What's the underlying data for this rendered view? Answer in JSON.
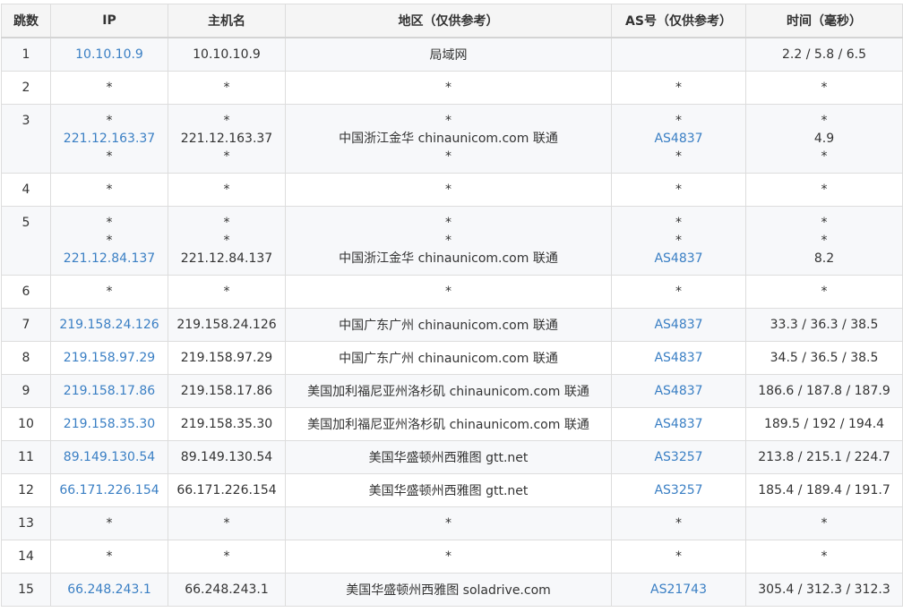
{
  "headers": [
    "跳数",
    "IP",
    "主机名",
    "地区（仅供参考）",
    "AS号（仅供参考）",
    "时间（毫秒）"
  ],
  "rows": [
    {
      "hop": "1",
      "ip": [
        "10.10.10.9"
      ],
      "host": [
        "10.10.10.9"
      ],
      "region": [
        "局域网"
      ],
      "as": [
        ""
      ],
      "time": [
        "2.2 / 5.8 / 6.5"
      ]
    },
    {
      "hop": "2",
      "ip": [
        "*"
      ],
      "host": [
        "*"
      ],
      "region": [
        "*"
      ],
      "as": [
        "*"
      ],
      "time": [
        "*"
      ]
    },
    {
      "hop": "3",
      "ip": [
        "*",
        "221.12.163.37",
        "*"
      ],
      "host": [
        "*",
        "221.12.163.37",
        "*"
      ],
      "region": [
        "*",
        "中国浙江金华 chinaunicom.com 联通",
        "*"
      ],
      "as": [
        "*",
        "AS4837",
        "*"
      ],
      "time": [
        "*",
        "4.9",
        "*"
      ]
    },
    {
      "hop": "4",
      "ip": [
        "*"
      ],
      "host": [
        "*"
      ],
      "region": [
        "*"
      ],
      "as": [
        "*"
      ],
      "time": [
        "*"
      ]
    },
    {
      "hop": "5",
      "ip": [
        "*",
        "*",
        "221.12.84.137"
      ],
      "host": [
        "*",
        "*",
        "221.12.84.137"
      ],
      "region": [
        "*",
        "*",
        "中国浙江金华 chinaunicom.com 联通"
      ],
      "as": [
        "*",
        "*",
        "AS4837"
      ],
      "time": [
        "*",
        "*",
        "8.2"
      ]
    },
    {
      "hop": "6",
      "ip": [
        "*"
      ],
      "host": [
        "*"
      ],
      "region": [
        "*"
      ],
      "as": [
        "*"
      ],
      "time": [
        "*"
      ]
    },
    {
      "hop": "7",
      "ip": [
        "219.158.24.126"
      ],
      "host": [
        "219.158.24.126"
      ],
      "region": [
        "中国广东广州 chinaunicom.com 联通"
      ],
      "as": [
        "AS4837"
      ],
      "time": [
        "33.3 / 36.3 / 38.5"
      ]
    },
    {
      "hop": "8",
      "ip": [
        "219.158.97.29"
      ],
      "host": [
        "219.158.97.29"
      ],
      "region": [
        "中国广东广州 chinaunicom.com 联通"
      ],
      "as": [
        "AS4837"
      ],
      "time": [
        "34.5 / 36.5 / 38.5"
      ]
    },
    {
      "hop": "9",
      "ip": [
        "219.158.17.86"
      ],
      "host": [
        "219.158.17.86"
      ],
      "region": [
        "美国加利福尼亚州洛杉矶 chinaunicom.com 联通"
      ],
      "as": [
        "AS4837"
      ],
      "time": [
        "186.6 / 187.8 / 187.9"
      ]
    },
    {
      "hop": "10",
      "ip": [
        "219.158.35.30"
      ],
      "host": [
        "219.158.35.30"
      ],
      "region": [
        "美国加利福尼亚州洛杉矶 chinaunicom.com 联通"
      ],
      "as": [
        "AS4837"
      ],
      "time": [
        "189.5 / 192 / 194.4"
      ]
    },
    {
      "hop": "11",
      "ip": [
        "89.149.130.54"
      ],
      "host": [
        "89.149.130.54"
      ],
      "region": [
        "美国华盛顿州西雅图 gtt.net"
      ],
      "as": [
        "AS3257"
      ],
      "time": [
        "213.8 / 215.1 / 224.7"
      ]
    },
    {
      "hop": "12",
      "ip": [
        "66.171.226.154"
      ],
      "host": [
        "66.171.226.154"
      ],
      "region": [
        "美国华盛顿州西雅图 gtt.net"
      ],
      "as": [
        "AS3257"
      ],
      "time": [
        "185.4 / 189.4 / 191.7"
      ]
    },
    {
      "hop": "13",
      "ip": [
        "*"
      ],
      "host": [
        "*"
      ],
      "region": [
        "*"
      ],
      "as": [
        "*"
      ],
      "time": [
        "*"
      ]
    },
    {
      "hop": "14",
      "ip": [
        "*"
      ],
      "host": [
        "*"
      ],
      "region": [
        "*"
      ],
      "as": [
        "*"
      ],
      "time": [
        "*"
      ]
    },
    {
      "hop": "15",
      "ip": [
        "66.248.243.1"
      ],
      "host": [
        "66.248.243.1"
      ],
      "region": [
        "美国华盛顿州西雅图 soladrive.com"
      ],
      "as": [
        "AS21743"
      ],
      "time": [
        "305.4 / 312.3 / 312.3"
      ]
    }
  ],
  "colors": {
    "link": "#3a7fc4",
    "text": "#333333",
    "border": "#dddddd",
    "header_bg": "#f5f5f5",
    "stripe": "#f7f8fa"
  }
}
